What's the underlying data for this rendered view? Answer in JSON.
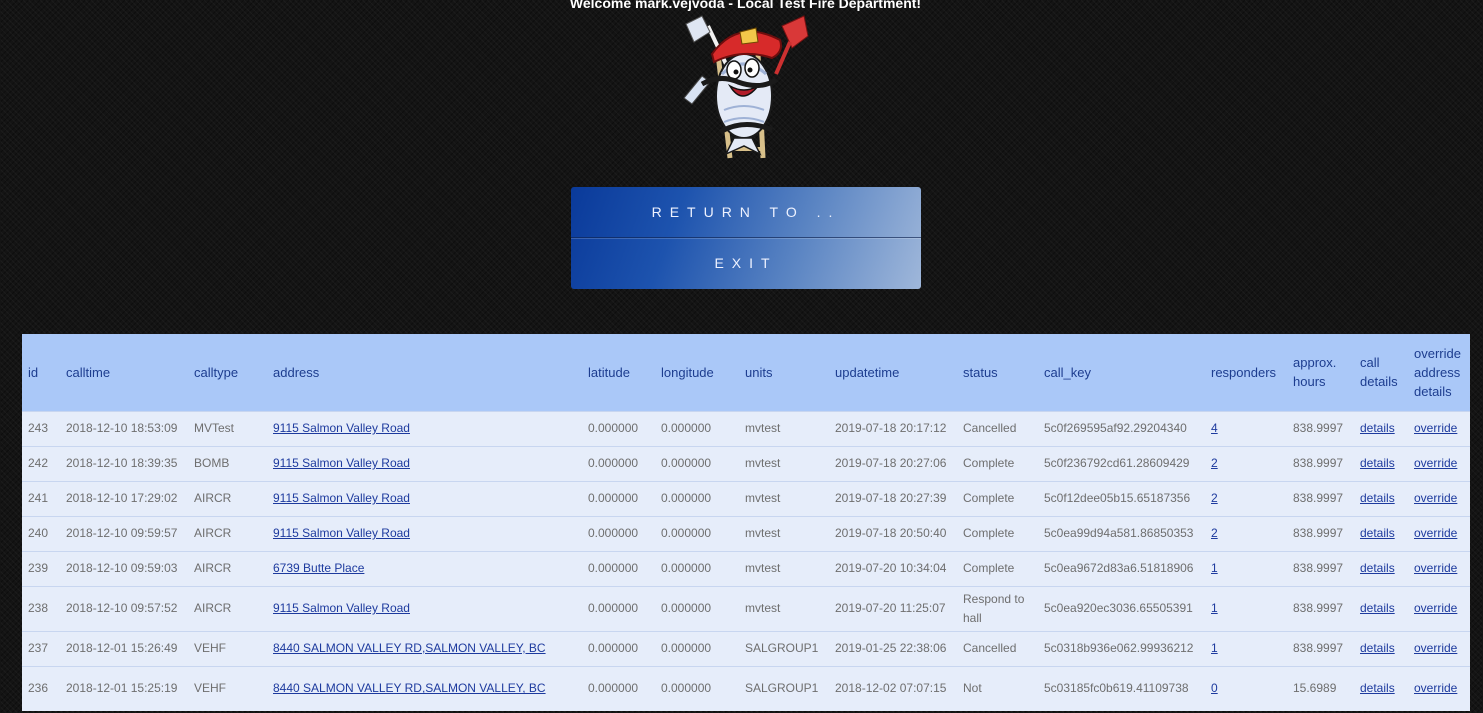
{
  "header": {
    "welcome": "Welcome mark.vejvoda - Local Test Fire Department!",
    "logo_icon": "firefighter-fish-mascot"
  },
  "menu": {
    "return_label": "RETURN TO ..",
    "exit_label": "EXIT"
  },
  "colors": {
    "table_header_bg": "#aac8f8",
    "table_row_bg": "#e6edfa",
    "link": "#1d3a9e"
  },
  "table": {
    "columns": [
      "id",
      "calltime",
      "calltype",
      "address",
      "latitude",
      "longitude",
      "units",
      "updatetime",
      "status",
      "call_key",
      "responders",
      "approx. hours",
      "call details",
      "override address details"
    ],
    "rows": [
      {
        "id": "243",
        "calltime": "2018-12-10 18:53:09",
        "calltype": "MVTest",
        "address": "9115 Salmon Valley Road",
        "latitude": "0.000000",
        "longitude": "0.000000",
        "units": "mvtest",
        "updatetime": "2019-07-18 20:17:12",
        "status": "Cancelled",
        "call_key": "5c0f269595af92.29204340",
        "responders": "4",
        "hours": "838.9997",
        "details": "details",
        "override": "override"
      },
      {
        "id": "242",
        "calltime": "2018-12-10 18:39:35",
        "calltype": "BOMB",
        "address": "9115 Salmon Valley Road",
        "latitude": "0.000000",
        "longitude": "0.000000",
        "units": "mvtest",
        "updatetime": "2019-07-18 20:27:06",
        "status": "Complete",
        "call_key": "5c0f236792cd61.28609429",
        "responders": "2",
        "hours": "838.9997",
        "details": "details",
        "override": "override"
      },
      {
        "id": "241",
        "calltime": "2018-12-10 17:29:02",
        "calltype": "AIRCR",
        "address": "9115 Salmon Valley Road",
        "latitude": "0.000000",
        "longitude": "0.000000",
        "units": "mvtest",
        "updatetime": "2019-07-18 20:27:39",
        "status": "Complete",
        "call_key": "5c0f12dee05b15.65187356",
        "responders": "2",
        "hours": "838.9997",
        "details": "details",
        "override": "override"
      },
      {
        "id": "240",
        "calltime": "2018-12-10 09:59:57",
        "calltype": "AIRCR",
        "address": "9115 Salmon Valley Road",
        "latitude": "0.000000",
        "longitude": "0.000000",
        "units": "mvtest",
        "updatetime": "2019-07-18 20:50:40",
        "status": "Complete",
        "call_key": "5c0ea99d94a581.86850353",
        "responders": "2",
        "hours": "838.9997",
        "details": "details",
        "override": "override"
      },
      {
        "id": "239",
        "calltime": "2018-12-10 09:59:03",
        "calltype": "AIRCR",
        "address": "6739 Butte Place",
        "latitude": "0.000000",
        "longitude": "0.000000",
        "units": "mvtest",
        "updatetime": "2019-07-20 10:34:04",
        "status": "Complete",
        "call_key": "5c0ea9672d83a6.51818906",
        "responders": "1",
        "hours": "838.9997",
        "details": "details",
        "override": "override"
      },
      {
        "id": "238",
        "calltime": "2018-12-10 09:57:52",
        "calltype": "AIRCR",
        "address": "9115 Salmon Valley Road",
        "latitude": "0.000000",
        "longitude": "0.000000",
        "units": "mvtest",
        "updatetime": "2019-07-20 11:25:07",
        "status": "Respond to hall",
        "call_key": "5c0ea920ec3036.65505391",
        "responders": "1",
        "hours": "838.9997",
        "details": "details",
        "override": "override"
      },
      {
        "id": "237",
        "calltime": "2018-12-01 15:26:49",
        "calltype": "VEHF",
        "address": "8440 SALMON VALLEY RD,SALMON VALLEY, BC",
        "latitude": "0.000000",
        "longitude": "0.000000",
        "units": "SALGROUP1",
        "updatetime": "2019-01-25 22:38:06",
        "status": "Cancelled",
        "call_key": "5c0318b936e062.99936212",
        "responders": "1",
        "hours": "838.9997",
        "details": "details",
        "override": "override"
      },
      {
        "id": "236",
        "calltime": "2018-12-01 15:25:19",
        "calltype": "VEHF",
        "address": "8440 SALMON VALLEY RD,SALMON VALLEY, BC",
        "latitude": "0.000000",
        "longitude": "0.000000",
        "units": "SALGROUP1",
        "updatetime": "2018-12-02 07:07:15",
        "status": "Not",
        "call_key": "5c03185fc0b619.41109738",
        "responders": "0",
        "hours": "15.6989",
        "details": "details",
        "override": "override"
      }
    ]
  }
}
